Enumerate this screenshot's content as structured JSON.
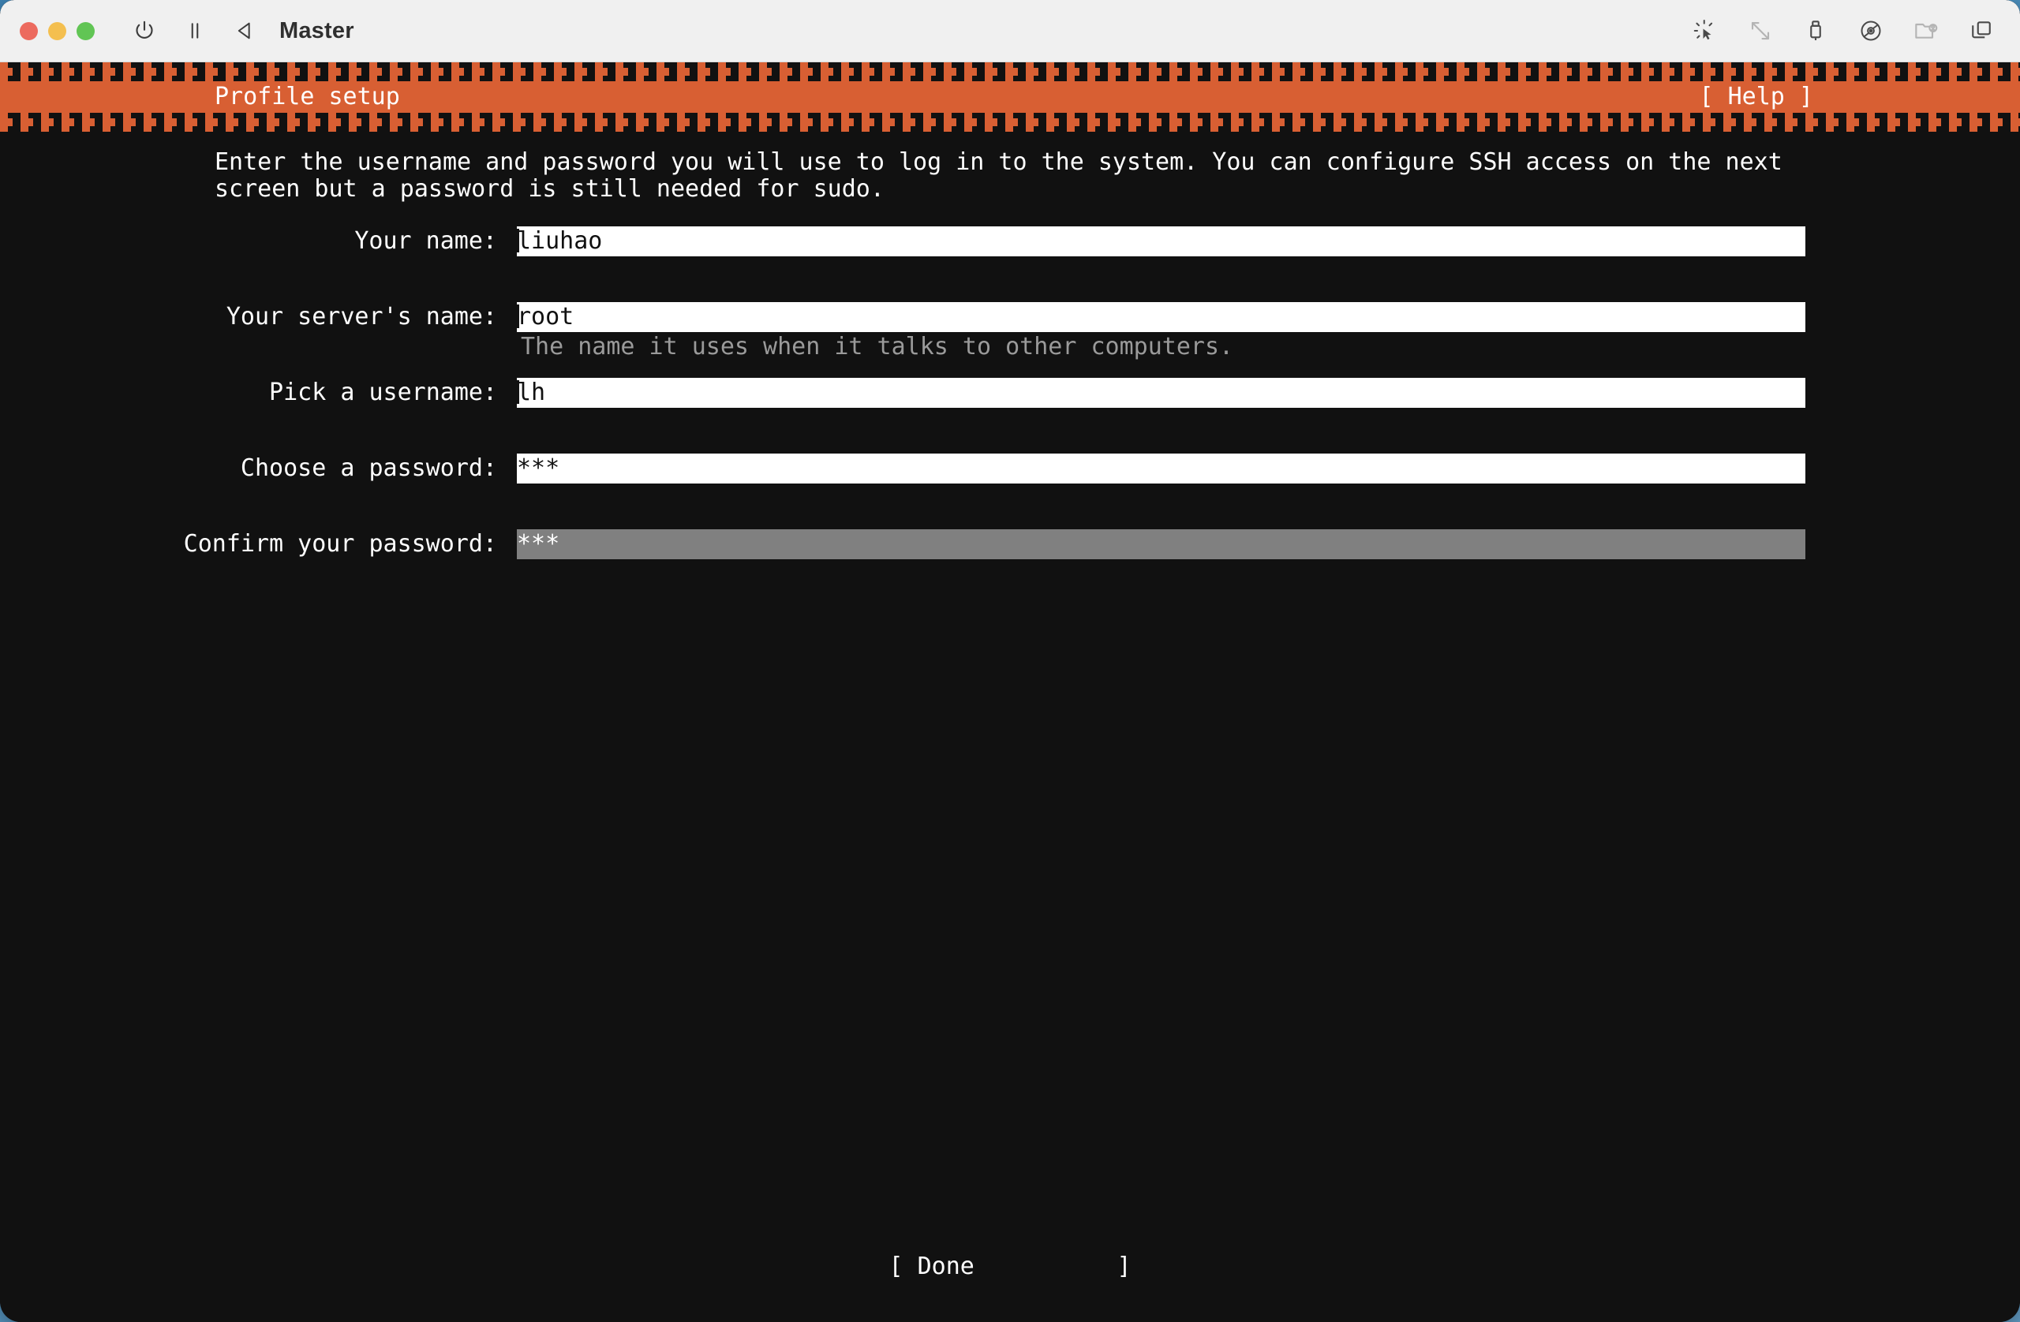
{
  "window": {
    "title": "Master",
    "traffic_lights": [
      "close",
      "minimize",
      "maximize"
    ],
    "left_icons": [
      {
        "name": "power-icon",
        "label": "Power"
      },
      {
        "name": "pause-icon",
        "label": "Pause"
      },
      {
        "name": "back-triangle-icon",
        "label": "Back"
      }
    ],
    "right_icons": [
      {
        "name": "cursor-click-icon",
        "label": "Pointer integration"
      },
      {
        "name": "resize-diagonal-icon",
        "label": "Resize"
      },
      {
        "name": "usb-icon",
        "label": "USB devices"
      },
      {
        "name": "optical-disc-icon",
        "label": "Optical drives"
      },
      {
        "name": "shared-folder-icon",
        "label": "Shared folders"
      },
      {
        "name": "windows-stack-icon",
        "label": "Windows"
      }
    ]
  },
  "colors": {
    "accent_orange": "#d85f33",
    "terminal_background": "#111111",
    "terminal_foreground": "#ffffff",
    "hint_gray": "#9a9a9a",
    "focused_field": "#808080",
    "titlebar": "#f0f0f0"
  },
  "installer": {
    "header": {
      "title": "Profile setup",
      "help_label": "[ Help ]"
    },
    "intro_text": "Enter the username and password you will use to log in to the system. You can configure SSH access on the next screen but a password is still needed for sudo.",
    "fields": [
      {
        "id": "your-name",
        "label": "Your name:",
        "value": "liuhao",
        "hint": "",
        "focused": false,
        "masked": false
      },
      {
        "id": "server-name",
        "label": "Your server's name:",
        "value": "root",
        "hint": "The name it uses when it talks to other computers.",
        "focused": false,
        "masked": false
      },
      {
        "id": "username",
        "label": "Pick a username:",
        "value": "lh",
        "hint": "",
        "focused": false,
        "masked": false
      },
      {
        "id": "password",
        "label": "Choose a password:",
        "value": "***",
        "hint": "",
        "focused": false,
        "masked": true
      },
      {
        "id": "confirm-password",
        "label": "Confirm your password:",
        "value": "***",
        "hint": "",
        "focused": true,
        "masked": true
      }
    ],
    "footer": {
      "done_label": "[ Done          ]"
    }
  }
}
